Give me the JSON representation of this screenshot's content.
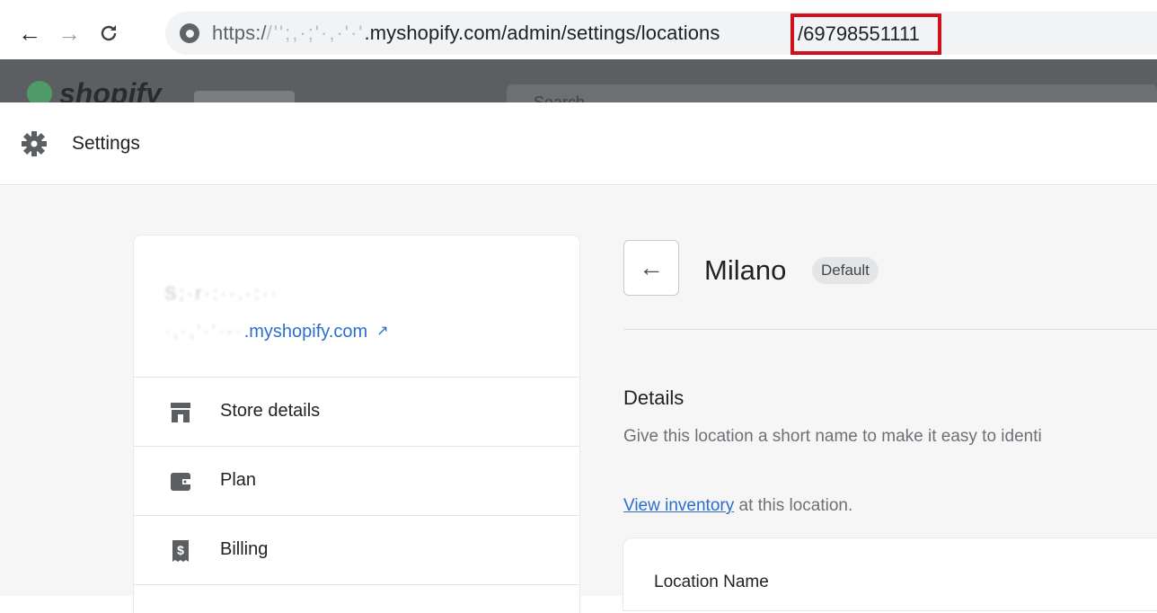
{
  "browser": {
    "back_icon": "back-arrow-icon",
    "forward_icon": "forward-arrow-icon",
    "reload_icon": "reload-icon",
    "url_prefix": "https:/",
    "url_domain": ".myshopify.com/admin/settings/locations",
    "url_location_id": "/69798551111",
    "highlight_color": "#d0101c"
  },
  "topbar": {
    "search_placeholder": "Search"
  },
  "settings": {
    "title": "Settings"
  },
  "sidebar": {
    "store_domain_suffix": ".myshopify.com",
    "items": [
      {
        "label": "Store details",
        "icon": "store-icon"
      },
      {
        "label": "Plan",
        "icon": "wallet-icon"
      },
      {
        "label": "Billing",
        "icon": "billing-icon"
      }
    ]
  },
  "location": {
    "title": "Milano",
    "badge": "Default",
    "details_heading": "Details",
    "details_description": "Give this location a short name to make it easy to identi",
    "inventory_link": "View inventory",
    "inventory_suffix": " at this location.",
    "field_label": "Location Name"
  },
  "colors": {
    "link": "#2c6ecb",
    "highlight": "#d0101c",
    "background": "#f6f6f7"
  }
}
